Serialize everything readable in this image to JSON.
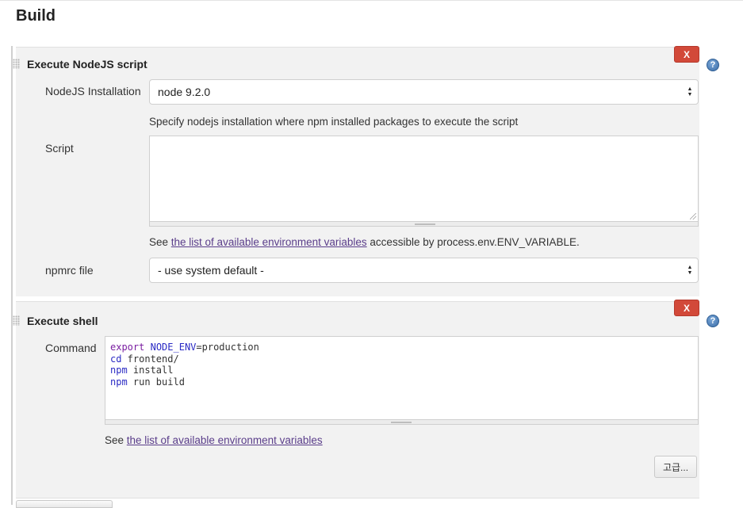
{
  "section": {
    "title": "Build"
  },
  "nodejs_step": {
    "title": "Execute NodeJS script",
    "delete_label": "X",
    "help_label": "?",
    "installation_label": "NodeJS Installation",
    "installation_value": "node 9.2.0",
    "installation_help": "Specify nodejs installation where npm installed packages to execute the script",
    "script_label": "Script",
    "script_value": "",
    "env_help_prefix": "See ",
    "env_help_link": "the list of available environment variables",
    "env_help_suffix": " accessible by process.env.ENV_VARIABLE.",
    "npmrc_label": "npmrc file",
    "npmrc_value": "- use system default -"
  },
  "shell_step": {
    "title": "Execute shell",
    "delete_label": "X",
    "help_label": "?",
    "command_label": "Command",
    "command_lines": [
      "export NODE_ENV=production",
      "cd frontend/",
      "npm install",
      "npm run build"
    ],
    "env_help_prefix": "See ",
    "env_help_link": "the list of available environment variables",
    "advanced_label": "고급..."
  },
  "colors": {
    "delete_red": "#d24939",
    "link_purple": "#5a3d8a",
    "keyword": "#7a1ea1",
    "variable": "#2a2ac4"
  }
}
